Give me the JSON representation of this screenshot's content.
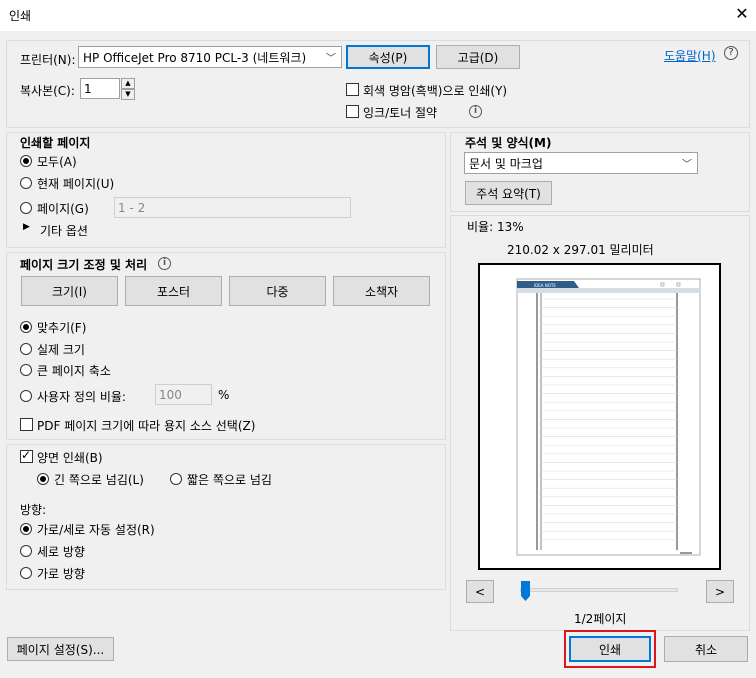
{
  "window": {
    "title": "인쇄",
    "close_icon": "close-icon"
  },
  "printer": {
    "label": "프린터(N):",
    "selected": "HP OfficeJet Pro 8710 PCL-3 (네트워크)",
    "properties_button": "속성(P)",
    "advanced_button": "고급(D)",
    "help_link": "도움말(H)",
    "copies_label": "복사본(C):",
    "copies_value": "1",
    "grayscale_label": "회색 명암(흑백)으로 인쇄(Y)",
    "grayscale_checked": false,
    "save_ink_label": "잉크/토너 절약",
    "save_ink_checked": false
  },
  "pages_to_print": {
    "heading": "인쇄할 페이지",
    "all": "모두(A)",
    "current": "현재 페이지(U)",
    "pages": "페이지(G)",
    "pages_value": "1 - 2",
    "more_options": "기타 옵션",
    "selected": "all"
  },
  "sizing": {
    "heading": "페이지 크기 조정 및 처리",
    "buttons": [
      "크기(I)",
      "포스터",
      "다중",
      "소책자"
    ],
    "fit": "맞추기(F)",
    "actual": "실제 크기",
    "shrink": "큰 페이지 축소",
    "custom": "사용자 정의 비율:",
    "custom_value": "100",
    "percent": "%",
    "pdf_paper_source": "PDF 페이지 크기에 따라 용지 소스 선택(Z)",
    "pdf_paper_source_checked": false,
    "selected": "fit"
  },
  "duplex": {
    "label": "양면 인쇄(B)",
    "checked": true,
    "long_edge": "긴 쪽으로 넘김(L)",
    "short_edge": "짧은 쪽으로 넘김",
    "selected": "long"
  },
  "orientation": {
    "heading": "방향:",
    "auto": "가로/세로 자동 설정(R)",
    "portrait": "세로 방향",
    "landscape": "가로 방향",
    "selected": "auto"
  },
  "comments": {
    "heading": "주석 및 양식(M)",
    "selected": "문서 및 마크업",
    "summarize_button": "주석 요약(T)"
  },
  "preview": {
    "scale": "비율:  13%",
    "dimensions": "210.02 x 297.01 밀리미터",
    "page_header": "IDEA NOTE",
    "prev": "<",
    "next": ">",
    "page_indicator": "1/2페이지",
    "slider_fraction": 0.0
  },
  "footer": {
    "page_setup": "페이지 설정(S)...",
    "print": "인쇄",
    "cancel": "취소"
  }
}
